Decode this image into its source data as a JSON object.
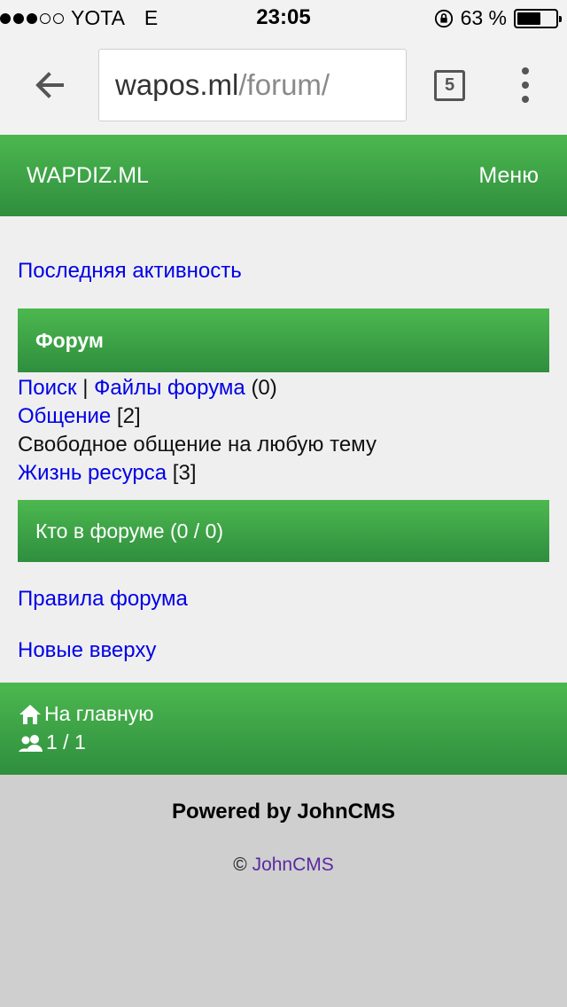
{
  "status_bar": {
    "carrier": "YOTA",
    "network": "E",
    "time": "23:05",
    "battery": "63 %",
    "signal_bars_filled": 3,
    "signal_bars_total": 5,
    "battery_level": 0.63
  },
  "browser": {
    "url_host": "wapos.ml",
    "url_path": "/forum/",
    "tab_count": "5",
    "icons": [
      "back-arrow-icon",
      "tabs-icon",
      "more-vert-icon"
    ]
  },
  "header": {
    "site_name": "WAPDIZ.ML",
    "menu_label": "Меню"
  },
  "content": {
    "last_activity": "Последняя активность",
    "forum_title": "Форум",
    "search_link": "Поиск",
    "separator": "|",
    "files_link": "Файлы форума",
    "files_count": "(0)",
    "chat_link": "Общение",
    "chat_count": "[2]",
    "chat_description": "Свободное общение на любую тему",
    "life_link": "Жизнь ресурса",
    "life_count": "[3]",
    "who_in_forum": "Кто в форуме (0 / 0)",
    "rules_link": "Правила форума",
    "newest_link": "Новые вверху"
  },
  "footer": {
    "home_label": "На главную",
    "online_count": "1 / 1",
    "powered_by": "Powered by JohnCMS",
    "copyright_symbol": "©",
    "copyright_link": "JohnCMS"
  },
  "colors": {
    "green_top": "#4cb84f",
    "green_bottom": "#2f8e3e",
    "link": "#0000e6",
    "visited_link": "#5a2aa0",
    "content_bg": "#efefef",
    "footer_bg": "#cfcfcf"
  }
}
